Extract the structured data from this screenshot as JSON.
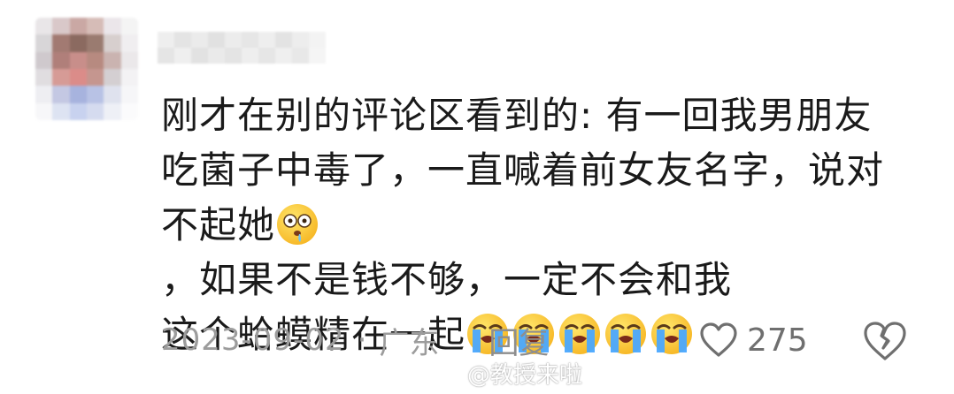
{
  "comment": {
    "lines": [
      "刚才在别的评论区看到的: 有一回我男朋友",
      "吃菌子中毒了，一直喊着前女友名字，说对",
      "不起她",
      "，如果不是钱不够，一定不会和我",
      "这个蛤蟆精在一起"
    ],
    "emojis": {
      "line3": "dizzy-drool-emoji",
      "line5": [
        "loudly-crying-emoji",
        "loudly-crying-emoji",
        "loudly-crying-emoji",
        "loudly-crying-emoji",
        "loudly-crying-emoji"
      ]
    },
    "date": "2023-09-02",
    "separator": "·",
    "location": "广东",
    "reply_label": "回复",
    "like_count": "275",
    "icons": {
      "like": "heart-outline-icon",
      "dislike": "broken-heart-icon"
    }
  },
  "watermark": {
    "text": "@教授来啦",
    "icon": "weibo-logo-icon"
  },
  "colors": {
    "text": "#1a1a1a",
    "meta": "#9c9c9c",
    "icon": "#6f6f6f",
    "emoji_face": "#ffd23f",
    "emoji_tear": "#4aa8ff"
  }
}
